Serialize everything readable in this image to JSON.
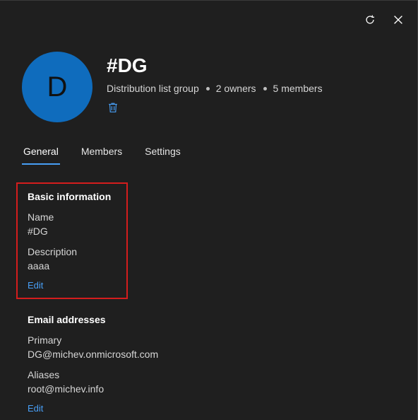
{
  "header": {
    "avatar_initial": "D",
    "title": "#DG",
    "type_label": "Distribution list group",
    "owners": "2 owners",
    "members": "5 members"
  },
  "tabs": [
    {
      "label": "General",
      "active": true
    },
    {
      "label": "Members",
      "active": false
    },
    {
      "label": "Settings",
      "active": false
    }
  ],
  "basic_info": {
    "title": "Basic information",
    "name_label": "Name",
    "name_value": "#DG",
    "description_label": "Description",
    "description_value": "aaaa",
    "edit_label": "Edit"
  },
  "email": {
    "title": "Email addresses",
    "primary_label": "Primary",
    "primary_value": "DG@michev.onmicrosoft.com",
    "aliases_label": "Aliases",
    "aliases_value": "root@michev.info",
    "edit_label": "Edit"
  },
  "colors": {
    "background": "#1f1f1f",
    "accent": "#479ef5",
    "avatar": "#0f6cbd",
    "highlight": "#d41d1d"
  },
  "icons": {
    "refresh": "refresh-icon",
    "close": "close-icon",
    "delete": "trash-icon"
  }
}
